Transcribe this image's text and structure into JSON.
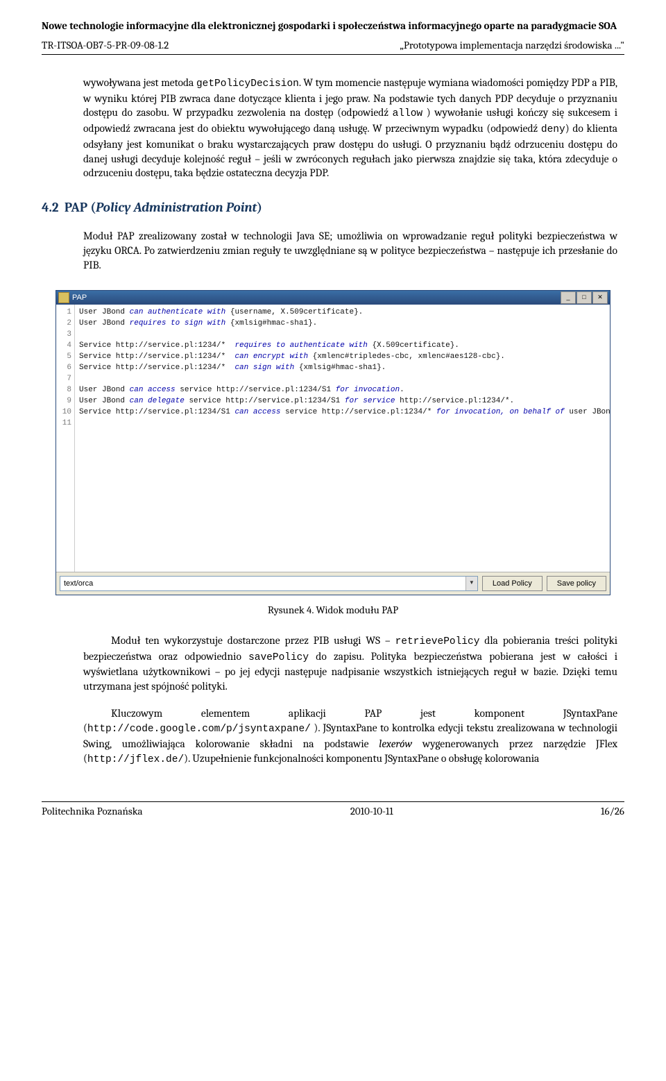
{
  "header": {
    "title": "Nowe technologie informacyjne dla elektronicznej gospodarki i społeczeństwa informacyjnego oparte na paradygmacie SOA",
    "doc_id": "TR-ITSOA-OB7-5-PR-09-08-1.2",
    "doc_right": "„Prototypowa implementacja narzędzi środowiska ...\""
  },
  "para1": {
    "t1": "wywoływana jest metoda ",
    "code1": "getPolicyDecision",
    "t2": ". W tym momencie następuje wymiana wiadomości pomiędzy PDP a PIB, w wyniku której PIB zwraca dane dotyczące klienta i jego praw. Na podstawie tych danych PDP decyduje o przyznaniu dostępu do zasobu. W przypadku zezwolenia na dostęp (odpowiedź ",
    "code2": "allow",
    "t3": " ) wywołanie usługi kończy się sukcesem i odpowiedź zwracana jest do obiektu wywołującego daną usługę. W przeciwnym wypadku (odpowiedź ",
    "code3": "deny",
    "t4": ") do klienta odsyłany jest komunikat o braku wystarczających praw dostępu do usługi. O przyznaniu bądź odrzuceniu dostępu do danej usługi decyduje kolejność reguł – jeśli w zwróconych regułach jako pierwsza znajdzie się taka, która zdecyduje o odrzuceniu dostępu, taka będzie ostateczna decyzja PDP."
  },
  "section": {
    "num": "4.2",
    "prefix": "PAP (",
    "italic": "Policy Administration Point",
    "suffix": ")"
  },
  "para2": "Moduł PAP zrealizowany został w technologii Java SE; umożliwia on wprowadzanie reguł polityki bezpieczeństwa w języku ORCA. Po zatwierdzeniu zmian reguły te uwzględniane są w polityce bezpieczeństwa – następuje ich przesłanie do PIB.",
  "pap": {
    "title": "PAP",
    "lines": [
      {
        "n": "1",
        "pre": "User JBond ",
        "kw": "can authenticate with",
        "post": " {username, X.509certificate}."
      },
      {
        "n": "2",
        "pre": "User JBond ",
        "kw": "requires to sign with",
        "post": " {xmlsig#hmac-sha1}."
      },
      {
        "n": "3",
        "pre": "",
        "kw": "",
        "post": ""
      },
      {
        "n": "4",
        "pre": "Service http://service.pl:1234/*  ",
        "kw": "requires to authenticate with",
        "post": " {X.509certificate}."
      },
      {
        "n": "5",
        "pre": "Service http://service.pl:1234/*  ",
        "kw": "can encrypt with",
        "post": " {xmlenc#tripledes-cbc, xmlenc#aes128-cbc}."
      },
      {
        "n": "6",
        "pre": "Service http://service.pl:1234/*  ",
        "kw": "can sign with",
        "post": " {xmlsig#hmac-sha1}."
      },
      {
        "n": "7",
        "pre": "",
        "kw": "",
        "post": ""
      },
      {
        "n": "8",
        "pre": "User JBond ",
        "kw": "can access",
        "post": " service http://service.pl:1234/S1 ",
        "kw2": "for invocation",
        "post2": "."
      },
      {
        "n": "9",
        "pre": "User JBond ",
        "kw": "can delegate",
        "post": " service http://service.pl:1234/S1 ",
        "kw2": "for service",
        "post2": " http://service.pl:1234/*."
      },
      {
        "n": "10",
        "pre": "Service http://service.pl:1234/S1 ",
        "kw": "can access",
        "post": " service http://service.pl:1234/* ",
        "kw2": "for invocation, on behalf of",
        "post2": " user JBond."
      },
      {
        "n": "11",
        "pre": "",
        "kw": "",
        "post": ""
      }
    ],
    "select_value": "text/orca",
    "btn_load": "Load Policy",
    "btn_save": "Save policy"
  },
  "figure_caption": "Rysunek 4. Widok modułu PAP",
  "para3": {
    "t1": "Moduł ten wykorzystuje dostarczone przez PIB usługi WS – ",
    "code1": "retrievePolicy",
    "t2": " dla pobierania treści polityki bezpieczeństwa oraz odpowiednio ",
    "code2": "savePolicy",
    "t3": " do zapisu. Polityka bezpieczeństwa pobierana jest w całości i wyświetlana użytkownikowi – po jej edycji następuje nadpisanie wszystkich istniejących reguł w bazie. Dzięki temu utrzymana jest spójność polityki."
  },
  "para4": {
    "t1": "Kluczowym elementem aplikacji PAP jest komponent JSyntaxPane (",
    "code1": "http://code.google.com/p/jsyntaxpane/",
    "t2": " ). JSyntaxPane to kontrolka edycji tekstu zrealizowana w technologii Swing, umożliwiająca kolorowanie składni na podstawie ",
    "italic": "lexerów",
    "t3": " wygenerowanych przez narzędzie JFlex (",
    "code2": "http://jflex.de/",
    "t4": "). Uzupełnienie funkcjonalności komponentu JSyntaxPane o obsługę kolorowania"
  },
  "footer": {
    "left": "Politechnika Poznańska",
    "center": "2010-10-11",
    "right": "16/26"
  }
}
